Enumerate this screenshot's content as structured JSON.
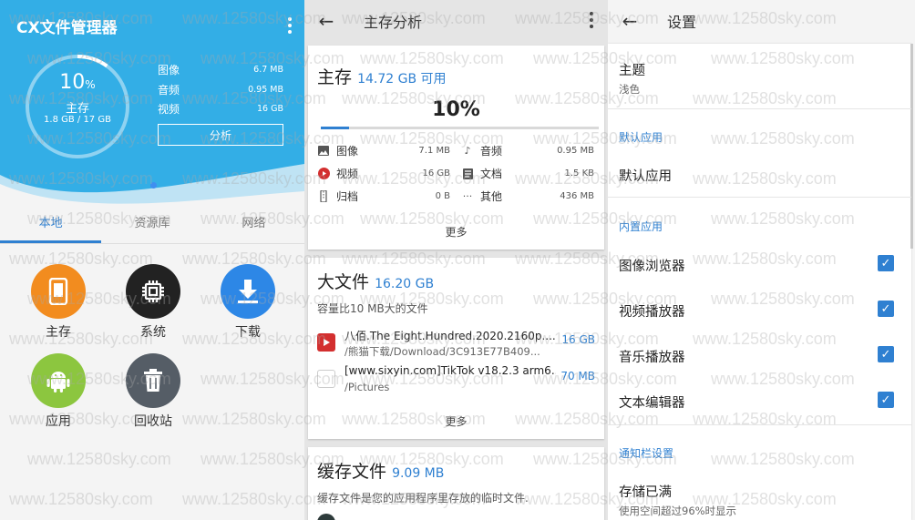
{
  "panel1": {
    "app_title": "CX文件管理器",
    "ring": {
      "percent": "10",
      "percent_sign": "%",
      "label": "主存",
      "size": "1.8 GB / 17 GB",
      "fraction": 0.1
    },
    "stats": [
      {
        "name": "图像",
        "value": "6.7 MB"
      },
      {
        "name": "音频",
        "value": "0.95 MB"
      },
      {
        "name": "视频",
        "value": "16 GB"
      }
    ],
    "analyze_label": "分析",
    "tabs": [
      "本地",
      "资源库",
      "网络"
    ],
    "grid": [
      {
        "label": "主存",
        "icon": "phone-icon",
        "color": "#f28c1f"
      },
      {
        "label": "系统",
        "icon": "chip-icon",
        "color": "#222222"
      },
      {
        "label": "下载",
        "icon": "download-icon",
        "color": "#2d87e6"
      },
      {
        "label": "应用",
        "icon": "android-icon",
        "color": "#8cc63f"
      },
      {
        "label": "回收站",
        "icon": "trash-icon",
        "color": "#555d66"
      }
    ]
  },
  "panel2": {
    "title": "主存分析",
    "storage": {
      "heading": "主存",
      "available": "14.72 GB 可用",
      "percent": "10%",
      "fraction": 0.1,
      "rows": [
        {
          "name": "图像",
          "size": "7.1 MB",
          "icon": "image-icon"
        },
        {
          "name": "音频",
          "size": "0.95 MB",
          "icon": "music-icon"
        },
        {
          "name": "视频",
          "size": "16 GB",
          "icon": "video-icon"
        },
        {
          "name": "文档",
          "size": "1.5 KB",
          "icon": "document-icon"
        },
        {
          "name": "归档",
          "size": "0 B",
          "icon": "archive-icon"
        },
        {
          "name": "其他",
          "size": "436 MB",
          "icon": "more-horizontal-icon"
        }
      ],
      "more": "更多"
    },
    "large_files": {
      "heading": "大文件",
      "size": "16.20 GB",
      "subtitle": "容量比10 MB大的文件",
      "files": [
        {
          "name": "八佰.The  Eight.Hundred.2020.2160p....",
          "path": "/熊猫下载/Download/3C913E77B409...",
          "size": "16 GB",
          "icon": "video-file-icon"
        },
        {
          "name": "[www.sixyin.com]TikTok v18.2.3 arm6...",
          "path": "/Pictures",
          "size": "70 MB",
          "icon": "blank-file-icon"
        }
      ],
      "more": "更多"
    },
    "cache": {
      "heading": "缓存文件",
      "size": "9.09 MB",
      "subtitle": "缓存文件是您的应用程序里存放的临时文件."
    }
  },
  "panel3": {
    "title": "设置",
    "theme": {
      "title": "主题",
      "value": "浅色"
    },
    "section_default": "默认应用",
    "default_app": "默认应用",
    "section_builtin": "内置应用",
    "builtin": [
      {
        "label": "图像浏览器",
        "checked": true
      },
      {
        "label": "视频播放器",
        "checked": true
      },
      {
        "label": "音乐播放器",
        "checked": true
      },
      {
        "label": "文本编辑器",
        "checked": true
      }
    ],
    "section_notify": "通知栏设置",
    "storage_full": {
      "title": "存储已满",
      "sub": "使用空间超过96%时显示"
    }
  },
  "watermark": "www.12580sky.com",
  "colors": {
    "accent": "#2f80d1",
    "hero": "#33aee6"
  }
}
